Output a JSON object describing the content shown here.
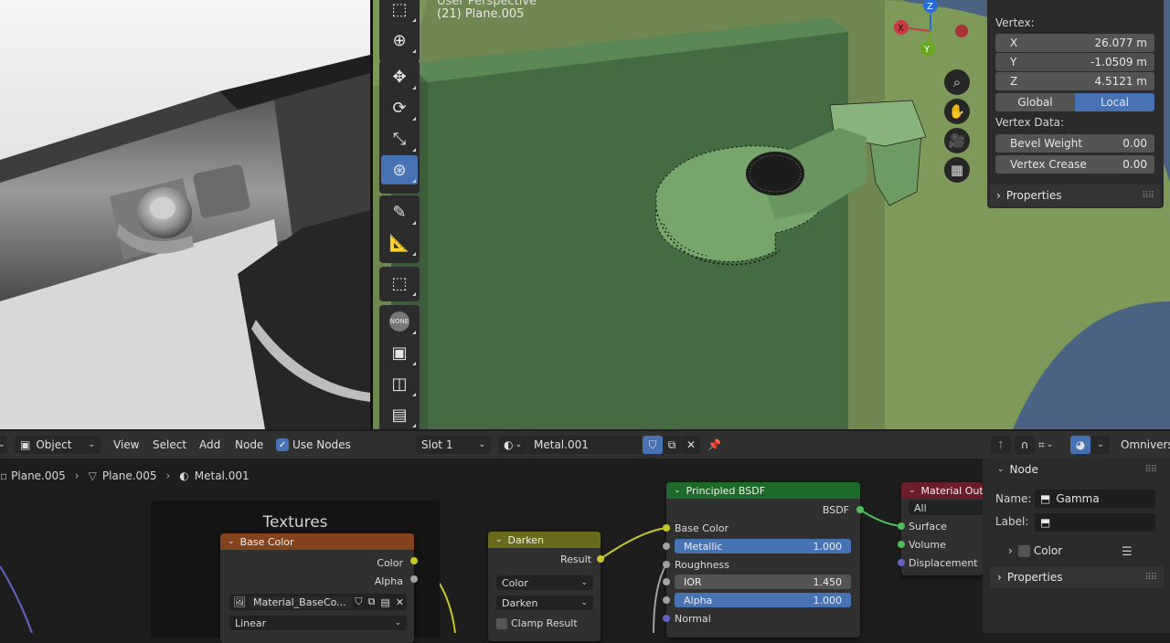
{
  "viewport": {
    "view_name": "User Perspective",
    "object_label": "(21) Plane.005",
    "gizmo": {
      "z": "Z",
      "y": "Y",
      "x": "X"
    }
  },
  "npanel": {
    "vertex_label": "Vertex:",
    "x_label": "X",
    "x_value": "26.077 m",
    "y_label": "Y",
    "y_value": "-1.0509 m",
    "z_label": "Z",
    "z_value": "4.5121 m",
    "global_label": "Global",
    "local_label": "Local",
    "vertex_data_label": "Vertex Data:",
    "bevel_label": "Bevel Weight",
    "bevel_value": "0.00",
    "crease_label": "Vertex Crease",
    "crease_value": "0.00",
    "properties_label": "Properties"
  },
  "header": {
    "mode": "Object",
    "menus": [
      "View",
      "Select",
      "Add",
      "Node"
    ],
    "use_nodes": "Use Nodes",
    "slot": "Slot 1",
    "material": "Metal.001",
    "render_engine": "Omniverse"
  },
  "breadcrumb": {
    "object": "Plane.005",
    "mesh": "Plane.005",
    "material": "Metal.001"
  },
  "nodes": {
    "frame_title": "Textures",
    "base_color": {
      "title": "Base Color",
      "out_color": "Color",
      "out_alpha": "Alpha",
      "image": "Material_BaseCo...",
      "interp": "Linear"
    },
    "darken": {
      "title": "Darken",
      "out_result": "Result",
      "color_mode": "Color",
      "blend_mode": "Darken",
      "clamp": "Clamp Result"
    },
    "bsdf": {
      "title": "Principled BSDF",
      "out_bsdf": "BSDF",
      "base_color": "Base Color",
      "metallic": "Metallic",
      "metallic_value": "1.000",
      "roughness": "Roughness",
      "ior": "IOR",
      "ior_value": "1.450",
      "alpha": "Alpha",
      "alpha_value": "1.000",
      "normal": "Normal"
    },
    "output": {
      "title": "Material Output",
      "target": "All",
      "surface": "Surface",
      "volume": "Volume",
      "displacement": "Displacement"
    }
  },
  "node_sidebar": {
    "node_header": "Node",
    "name_label": "Name:",
    "name_value": "Gamma",
    "label_label": "Label:",
    "label_value": "",
    "color_label": "Color",
    "properties_label": "Properties"
  },
  "colors": {
    "accent": "#4772b3",
    "image_node": "#83431c",
    "mix_node": "#6a6a1c",
    "shader_node": "#1d6a2a",
    "output_node": "#6b1e2a",
    "mesh_green": "#6e9a63"
  }
}
